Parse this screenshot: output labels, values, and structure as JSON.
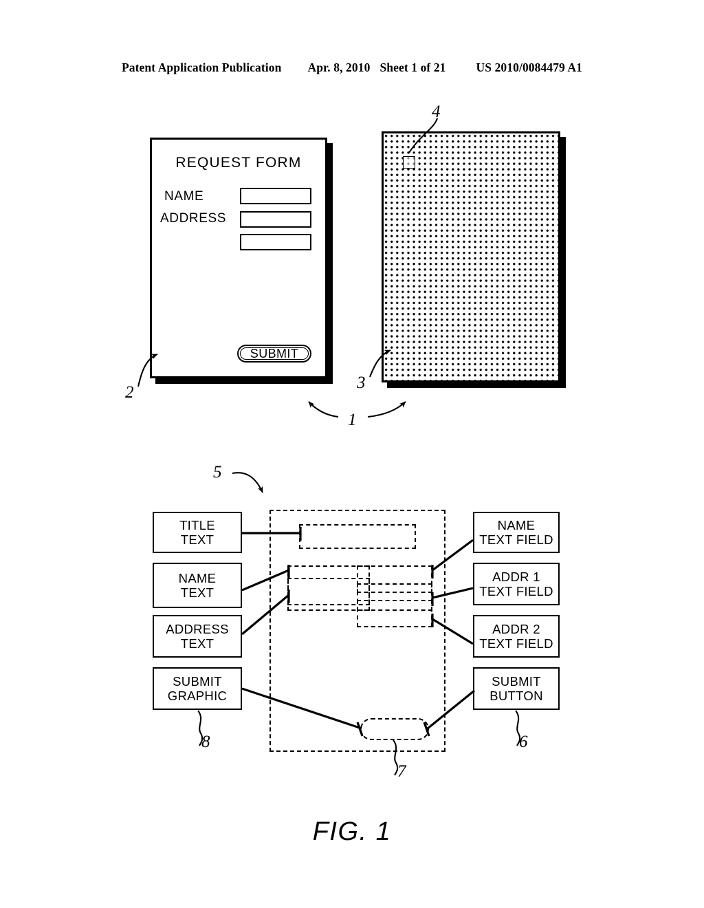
{
  "header": {
    "publication": "Patent Application Publication",
    "date": "Apr. 8, 2010",
    "sheet": "Sheet 1 of 21",
    "patent_number": "US 2010/0084479 A1"
  },
  "figure": {
    "caption": "FIG. 1"
  },
  "printed_form": {
    "title": "REQUEST FORM",
    "label_name": "NAME",
    "label_address": "ADDRESS",
    "submit_label": "SUBMIT",
    "input_values": [
      "",
      "",
      ""
    ]
  },
  "coded_surface": {
    "description": "dot pattern coded surface"
  },
  "reference_numerals": {
    "n1": "1",
    "n2": "2",
    "n3": "3",
    "n4": "4",
    "n5": "5",
    "n6": "6",
    "n7": "7",
    "n8": "8"
  },
  "block_diagram": {
    "left_column": [
      {
        "line1": "TITLE",
        "line2": "TEXT"
      },
      {
        "line1": "NAME",
        "line2": "TEXT"
      },
      {
        "line1": "ADDRESS",
        "line2": "TEXT"
      },
      {
        "line1": "SUBMIT",
        "line2": "GRAPHIC"
      }
    ],
    "right_column": [
      {
        "line1": "NAME",
        "line2": "TEXT FIELD"
      },
      {
        "line1": "ADDR 1",
        "line2": "TEXT FIELD"
      },
      {
        "line1": "ADDR 2",
        "line2": "TEXT FIELD"
      },
      {
        "line1": "SUBMIT",
        "line2": "BUTTON"
      }
    ]
  }
}
